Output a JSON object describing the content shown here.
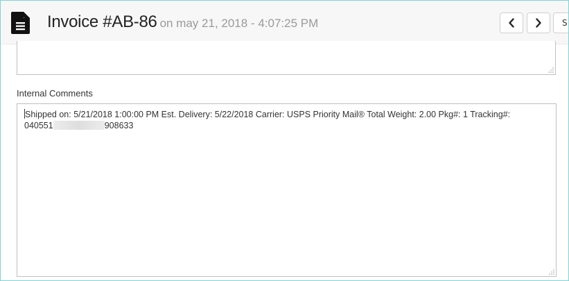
{
  "header": {
    "title": "Invoice #AB-86",
    "subtitle": "on may 21, 2018 - 4:07:25 PM",
    "icon": "document-icon",
    "prev_icon": "chevron-left-icon",
    "next_icon": "chevron-right-icon",
    "cut_button_label": "S"
  },
  "comments_section": {
    "label": "Internal Comments",
    "text_part1": "Shipped on: 5/21/2018 1:00:00 PM Est. Delivery: 5/22/2018 Carrier: USPS Priority Mail® Total Weight: 2.00 Pkg#: 1 Tracking#:\n040551",
    "text_part2": "908633"
  },
  "colors": {
    "frame_border": "#7fd3d6",
    "header_bg": "#f7f7f7"
  }
}
